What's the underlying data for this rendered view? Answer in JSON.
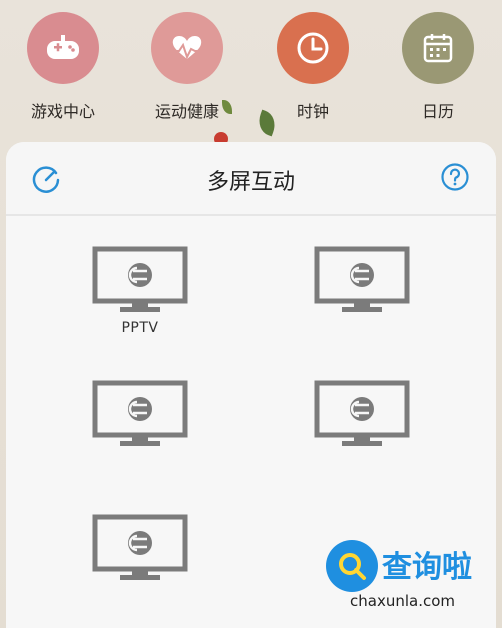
{
  "home_apps": [
    {
      "label": "游戏中心",
      "icon": "gamepad-icon",
      "color": "#d98c90"
    },
    {
      "label": "运动健康",
      "icon": "heart-pulse-icon",
      "color": "#df9a98"
    },
    {
      "label": "时钟",
      "icon": "clock-icon",
      "color": "#d9704f"
    },
    {
      "label": "日历",
      "icon": "calendar-icon",
      "color": "#9a9874"
    }
  ],
  "dialog": {
    "title": "多屏互动",
    "refresh_icon": "refresh-icon",
    "help_icon": "help-icon",
    "accent": "#2a8fd4"
  },
  "devices": [
    {
      "name": "PPTV",
      "icon": "tv-cast-icon"
    },
    {
      "name": "",
      "icon": "tv-cast-icon"
    },
    {
      "name": "",
      "icon": "tv-cast-icon"
    },
    {
      "name": "",
      "icon": "tv-cast-icon"
    },
    {
      "name": "",
      "icon": "tv-cast-icon"
    }
  ],
  "watermark": {
    "title": "查询啦",
    "url": "chaxunla.com"
  }
}
